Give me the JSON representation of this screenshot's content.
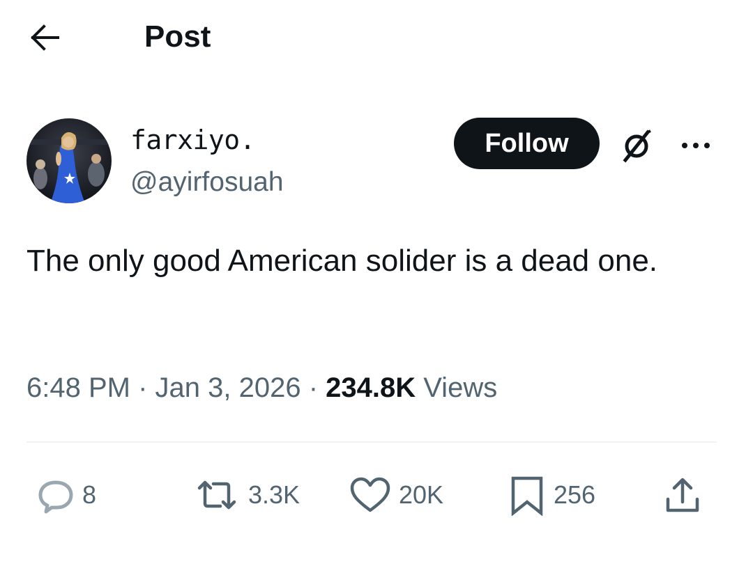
{
  "header": {
    "back_icon": "arrow-left-icon",
    "title": "Post"
  },
  "author": {
    "avatar_alt": "profile-photo",
    "display_name": "farxiyo.",
    "handle": "@ayirfosuah"
  },
  "actions_top": {
    "follow_label": "Follow",
    "grok_icon": "grok-icon",
    "more_icon": "more-icon"
  },
  "post": {
    "text": "The only good American solider is a dead one."
  },
  "meta": {
    "time": "6:48 PM",
    "sep1": " · ",
    "date": "Jan 3, 2026",
    "sep2": " · ",
    "views_count": "234.8K",
    "views_label": " Views"
  },
  "engagement": {
    "replies": "8",
    "reposts": "3.3K",
    "likes": "20K",
    "bookmarks": "256"
  },
  "colors": {
    "text_primary": "#0f1419",
    "text_secondary": "#536471",
    "divider": "#eff3f4",
    "follow_bg": "#0f1419",
    "reply_icon": "#9aa7b1"
  }
}
